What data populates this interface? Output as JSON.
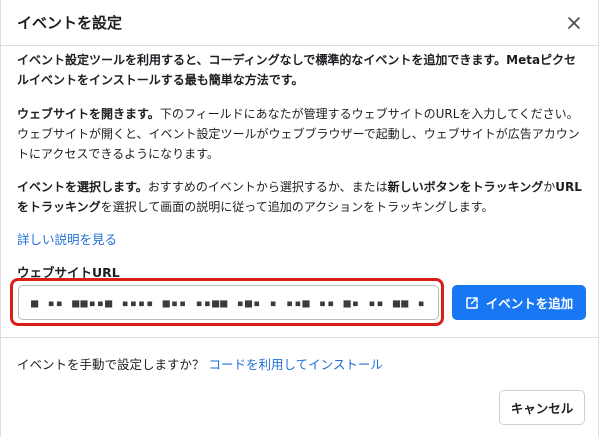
{
  "dialog": {
    "title": "イベントを設定"
  },
  "body": {
    "intro": "イベント設定ツールを利用すると、コーディングなしで標準的なイベントを追加できます。Metaピクセルイベントをインストールする最も簡単な方法です。",
    "step1_lead": "ウェブサイトを開きます。",
    "step1_text": "下のフィールドにあなたが管理するウェブサイトのURLを入力してください。ウェブサイトが開くと、イベント設定ツールがウェブブラウザーで起動し、ウェブサイトが広告アカウントにアクセスできるようになります。",
    "step2_lead": "イベントを選択します。",
    "step2_text_a": "おすすめのイベントから選択するか、または",
    "step2_bold_a": "新しいボタンをトラッキング",
    "step2_text_b": "か",
    "step2_bold_b": "URLをトラッキング",
    "step2_text_c": "を選択して画面の説明に従って追加のアクションをトラッキングします。",
    "details_link": "詳しい説明を見る"
  },
  "url_field": {
    "label": "ウェブサイトURL",
    "value": "■ ▪▪ ■■▪▪■ ▪▪▪▪ ■▪▪ ▪▪■■ ▪■▪ ▪ ▪▪■ ▪▪ ■▪ ▪▪ ■■ ▪▪"
  },
  "add_event_button": {
    "label": "イベントを追加",
    "icon": "open-external-icon"
  },
  "footer": {
    "manual_question": "イベントを手動で設定しますか？",
    "manual_link": "コードを利用してインストール",
    "cancel_label": "キャンセル"
  },
  "colors": {
    "primary": "#1877f2",
    "link": "#216fdb",
    "highlight_border": "#d91e18"
  }
}
